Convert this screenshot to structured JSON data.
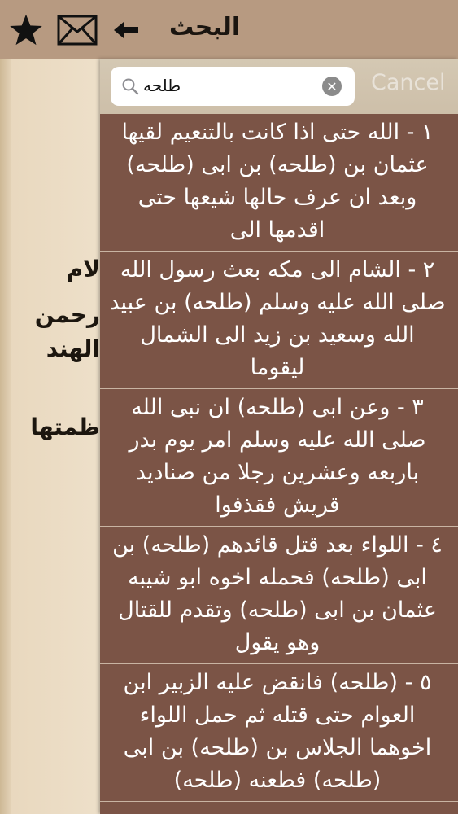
{
  "nav": {
    "title": "البحث",
    "back_icon": "arrow-left-icon",
    "mail_icon": "envelope-icon",
    "star_icon": "star-icon"
  },
  "background_text": [
    "لام",
    "رحمن",
    "الهند",
    "ظمتها"
  ],
  "search": {
    "query": "طلحه",
    "cancel_label": "Cancel",
    "icon": "search-icon"
  },
  "results": [
    [
      "١ - الله  حتى اذا كانت بالتنعيم لقيها",
      "عثمان بن (طلحه) بن ابى (طلحه)",
      "وبعد ان عرف حالها شيعها حتى",
      "اقدمها الى"
    ],
    [
      "٢ - الشام الى مكه بعث رسول الله",
      "صلى الله عليه وسلم (طلحه) بن عبيد",
      "الله وسعيد بن زيد الى الشمال",
      "ليقوما"
    ],
    [
      "٣ - وعن ابى (طلحه) ان نبى الله",
      "صلى الله عليه وسلم امر يوم بدر",
      "باربعه وعشرين رجلا من صناديد",
      "قريش  فقذفوا"
    ],
    [
      "٤ - اللواء بعد قتل قائدهم (طلحه) بن",
      "ابى (طلحه)  فحمله اخوه ابو شيبه",
      "عثمان بن ابى (طلحه)  وتقدم للقتال",
      "وهو يقول"
    ],
    [
      "٥ - (طلحه)  فانقض عليه الزبير ابن",
      "العوام حتى قتله  ثم حمل اللواء",
      "اخوهما الجلاس بن (طلحه) بن ابى",
      "(طلحه)  فطعنه (طلحه)"
    ]
  ],
  "colors": {
    "navbar": "#b79a81",
    "overlay": "#7b5446",
    "result_text": "#ffffff",
    "cancel_text": "#e8e2d8"
  }
}
